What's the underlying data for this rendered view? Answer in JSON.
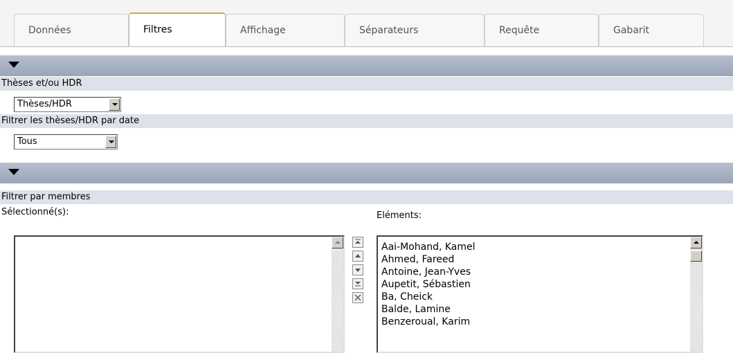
{
  "tabs": [
    {
      "label": "Données",
      "active": false
    },
    {
      "label": "Filtres",
      "active": true
    },
    {
      "label": "Affichage",
      "active": false
    },
    {
      "label": "Séparateurs",
      "active": false
    },
    {
      "label": "Requête",
      "active": false
    },
    {
      "label": "Gabarit",
      "active": false
    }
  ],
  "filters": {
    "theses_label": "Thèses et/ou HDR",
    "theses_select_value": "Thèses/HDR",
    "date_label": "Filtrer les thèses/HDR par date",
    "date_select_value": "Tous"
  },
  "members": {
    "section_label": "Filtrer par membres",
    "selected_label": "Sélectionné(s):",
    "elements_label": "Eléments:",
    "elements": [
      "Aai-Mohand, Kamel",
      "Ahmed, Fareed",
      "Antoine, Jean-Yves",
      "Aupetit, Sébastien",
      "Ba, Cheick",
      "Balde, Lamine",
      "Benzeroual, Karim"
    ]
  },
  "colors": {
    "section_bar": "#a7b1c4",
    "label_row": "#dde1e9",
    "active_tab_accent": "#d9a441"
  },
  "icons": {
    "collapse": "triangle-down-icon",
    "move_top": "move-top-icon",
    "move_up": "move-up-icon",
    "move_down": "move-down-icon",
    "move_bottom": "move-bottom-icon",
    "remove": "remove-x-icon"
  }
}
